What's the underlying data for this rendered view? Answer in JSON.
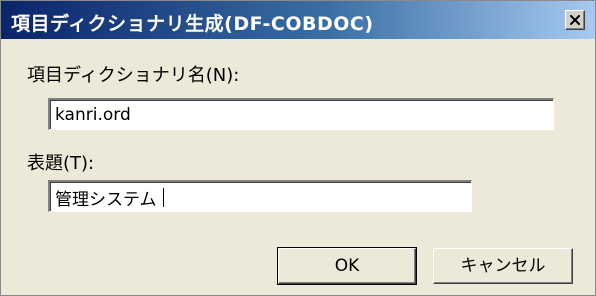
{
  "dialog": {
    "title": "項目ディクショナリ生成(DF-COBDOC)",
    "dictionary_name": {
      "label": "項目ディクショナリ名(N):",
      "value": "kanri.ord"
    },
    "caption": {
      "label": "表題(T):",
      "value": "管理システム"
    },
    "buttons": {
      "ok": "OK",
      "cancel": "キャンセル"
    },
    "close_icon": "close-x-icon"
  }
}
